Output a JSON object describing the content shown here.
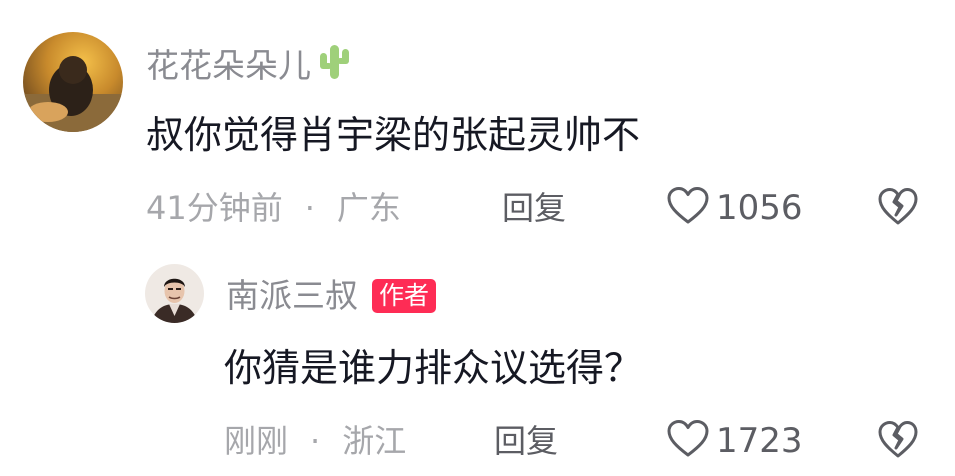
{
  "comment": {
    "username": "花花朵朵儿",
    "username_emoji_icon": "cactus-icon",
    "text": "叔你觉得肖宇梁的张起灵帅不",
    "time": "41分钟前",
    "separator": "·",
    "location": "广东",
    "reply_label": "回复",
    "like_count": "1056"
  },
  "reply": {
    "username": "南派三叔",
    "author_badge": "作者",
    "text": "你猜是谁力排众议选得？",
    "time": "刚刚",
    "separator": "·",
    "location": "浙江",
    "reply_label": "回复",
    "like_count": "1723"
  },
  "colors": {
    "badge": "#fe2c55",
    "username": "#8a8b91",
    "meta": "#a6a7ab",
    "action": "#5c5d63",
    "text": "#161823"
  }
}
